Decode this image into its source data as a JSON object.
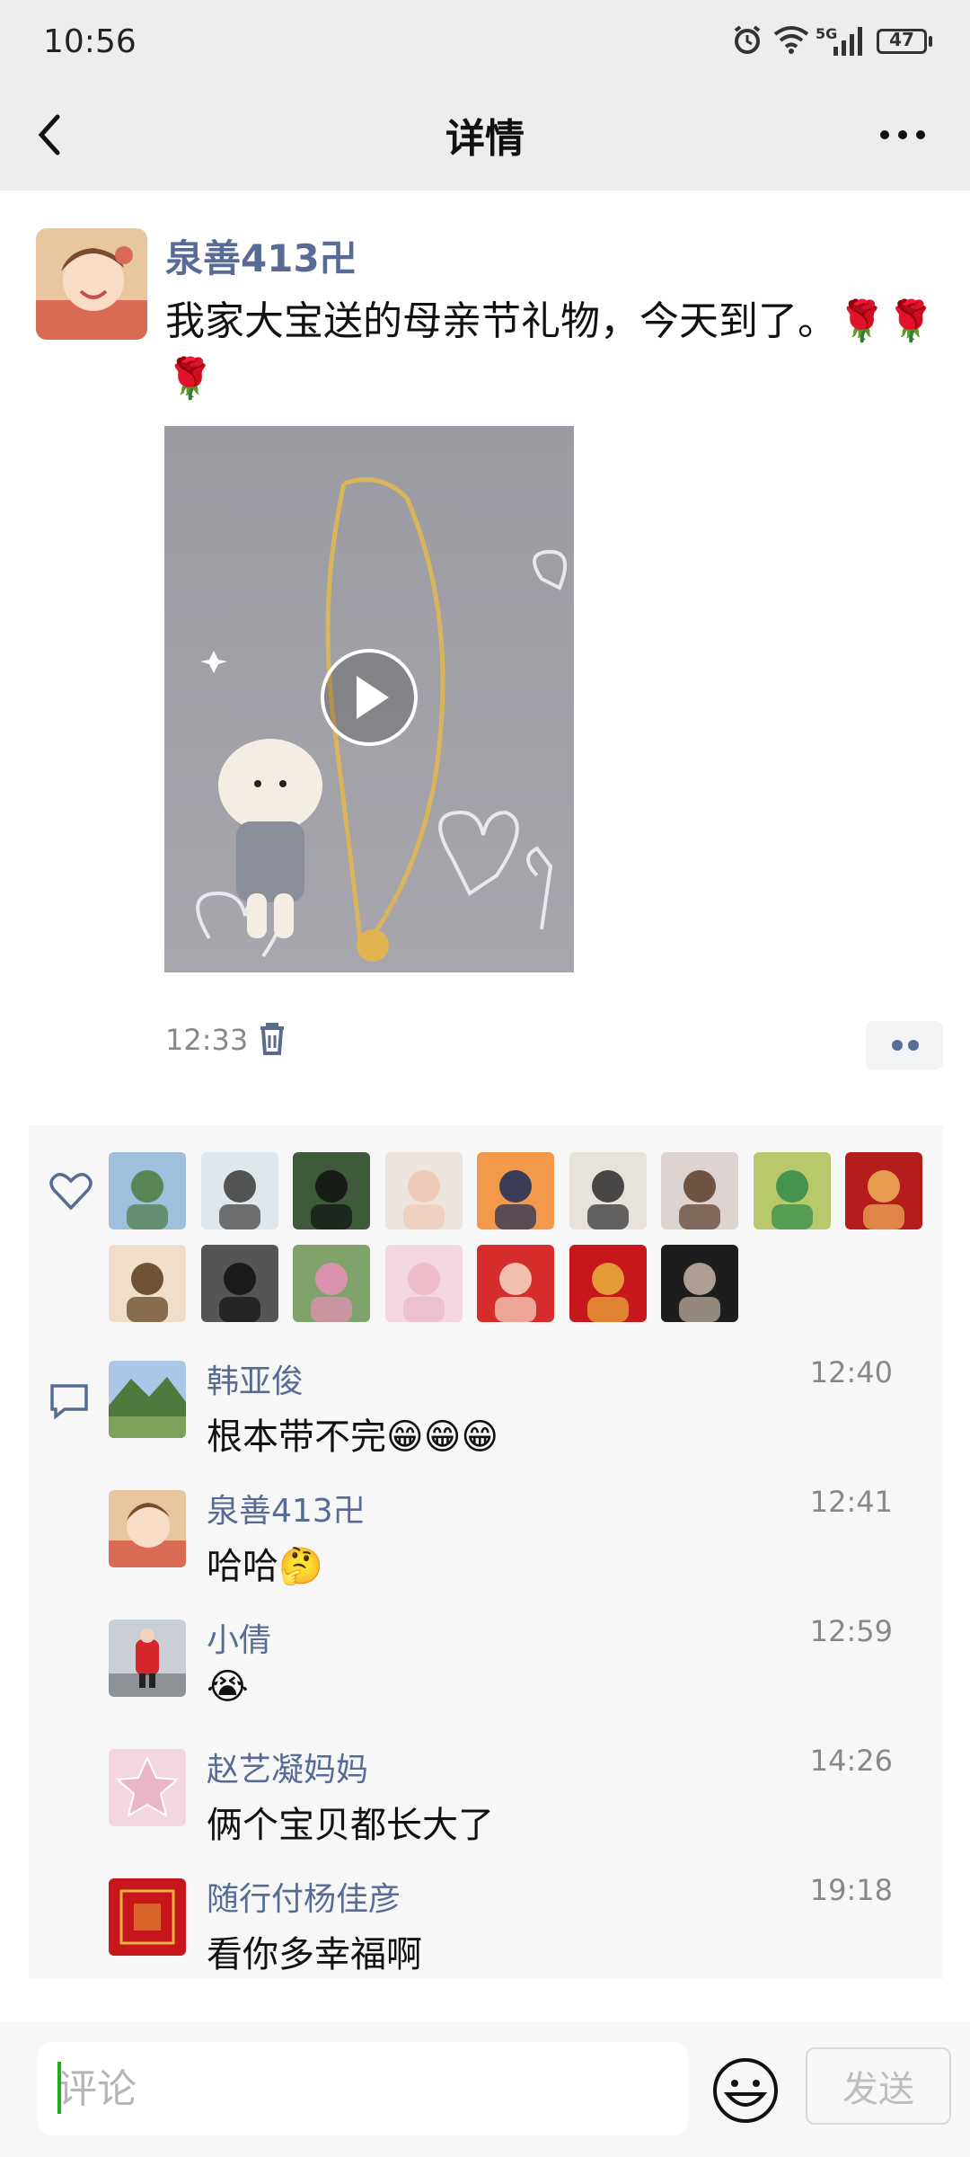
{
  "status_bar": {
    "time": "10:56",
    "network": "5G",
    "battery": "47"
  },
  "header": {
    "title": "详情"
  },
  "post": {
    "author": "泉善413卍",
    "text": "我家大宝送的母亲节礼物，今天到了。🌹🌹🌹",
    "time": "12:33",
    "media_type": "video"
  },
  "likes": {
    "icon": "heart-outline-icon",
    "count_avatars": 16
  },
  "comments": [
    {
      "name": "韩亚俊",
      "time": "12:40",
      "text": "根本带不完😁😁😁"
    },
    {
      "name": "泉善413卍",
      "time": "12:41",
      "text": "哈哈🤔"
    },
    {
      "name": "小倩",
      "time": "12:59",
      "text": "😭"
    },
    {
      "name": "赵艺凝妈妈",
      "time": "14:26",
      "text": "俩个宝贝都长大了"
    },
    {
      "name": "随行付杨佳彦",
      "time": "19:18",
      "text": "看你多幸福啊"
    }
  ],
  "bottom_bar": {
    "input_placeholder": "评论",
    "send_label": "发送"
  },
  "colors": {
    "name_blue": "#576b95",
    "header_bg": "#ededed",
    "panel_bg": "#f7f7f7"
  }
}
